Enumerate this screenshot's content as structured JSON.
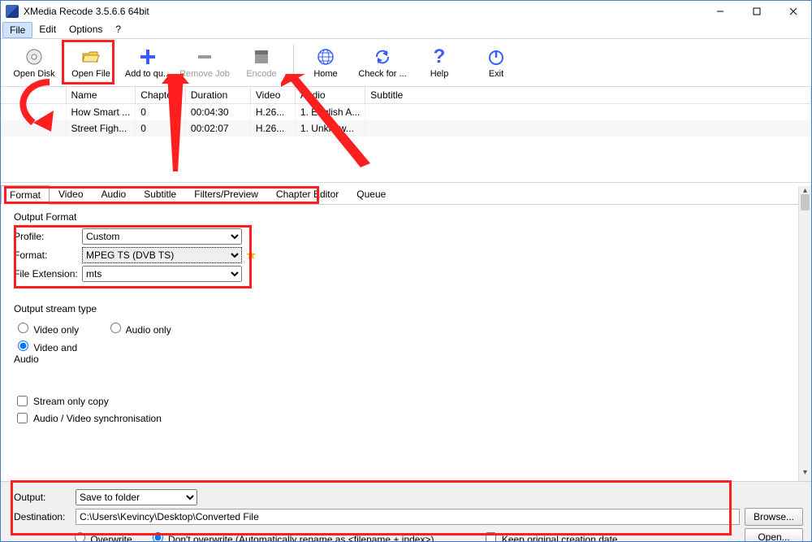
{
  "title": "XMedia Recode 3.5.6.6 64bit",
  "menu": {
    "file": "File",
    "edit": "Edit",
    "options": "Options",
    "help": "?"
  },
  "toolbar": {
    "open_disk": "Open Disk",
    "open_file": "Open File",
    "add_queue": "Add to qu...",
    "remove_job": "Remove Job",
    "encode": "Encode",
    "home": "Home",
    "check_updates": "Check for ...",
    "help": "Help",
    "exit": "Exit"
  },
  "filelist": {
    "headers": {
      "name": "Name",
      "chapters": "Chapters",
      "duration": "Duration",
      "video": "Video",
      "audio": "Audio",
      "subtitle": "Subtitle"
    },
    "rows": [
      {
        "name": "How Smart ...",
        "chapters": "0",
        "duration": "00:04:30",
        "video": "H.26...",
        "audio": "1. English A...",
        "subtitle": ""
      },
      {
        "name": "Street Figh...",
        "chapters": "0",
        "duration": "00:02:07",
        "video": "H.26...",
        "audio": "1. Unknow...",
        "subtitle": ""
      }
    ]
  },
  "tabs": {
    "format": "Format",
    "video": "Video",
    "audio": "Audio",
    "subtitle": "Subtitle",
    "filters": "Filters/Preview",
    "chapters": "Chapter Editor",
    "queue": "Queue"
  },
  "format_panel": {
    "output_format_title": "Output Format",
    "profile_label": "Profile:",
    "profile_value": "Custom",
    "format_label": "Format:",
    "format_value": "MPEG TS (DVB TS)",
    "ext_label": "File Extension:",
    "ext_value": "mts",
    "stream_title": "Output stream type",
    "video_only": "Video only",
    "audio_only": "Audio only",
    "video_audio": "Video and Audio",
    "stream_copy": "Stream only copy",
    "av_sync": "Audio / Video synchronisation"
  },
  "bottom": {
    "output_label": "Output:",
    "output_value": "Save to folder",
    "destination_label": "Destination:",
    "destination_value": "C:\\Users\\Kevincy\\Desktop\\Converted File",
    "overwrite": "Overwrite",
    "dont_overwrite": "Don't overwrite (Automatically rename as <filename + index>)",
    "keep_date": "Keep original creation date",
    "browse": "Browse...",
    "open": "Open..."
  }
}
